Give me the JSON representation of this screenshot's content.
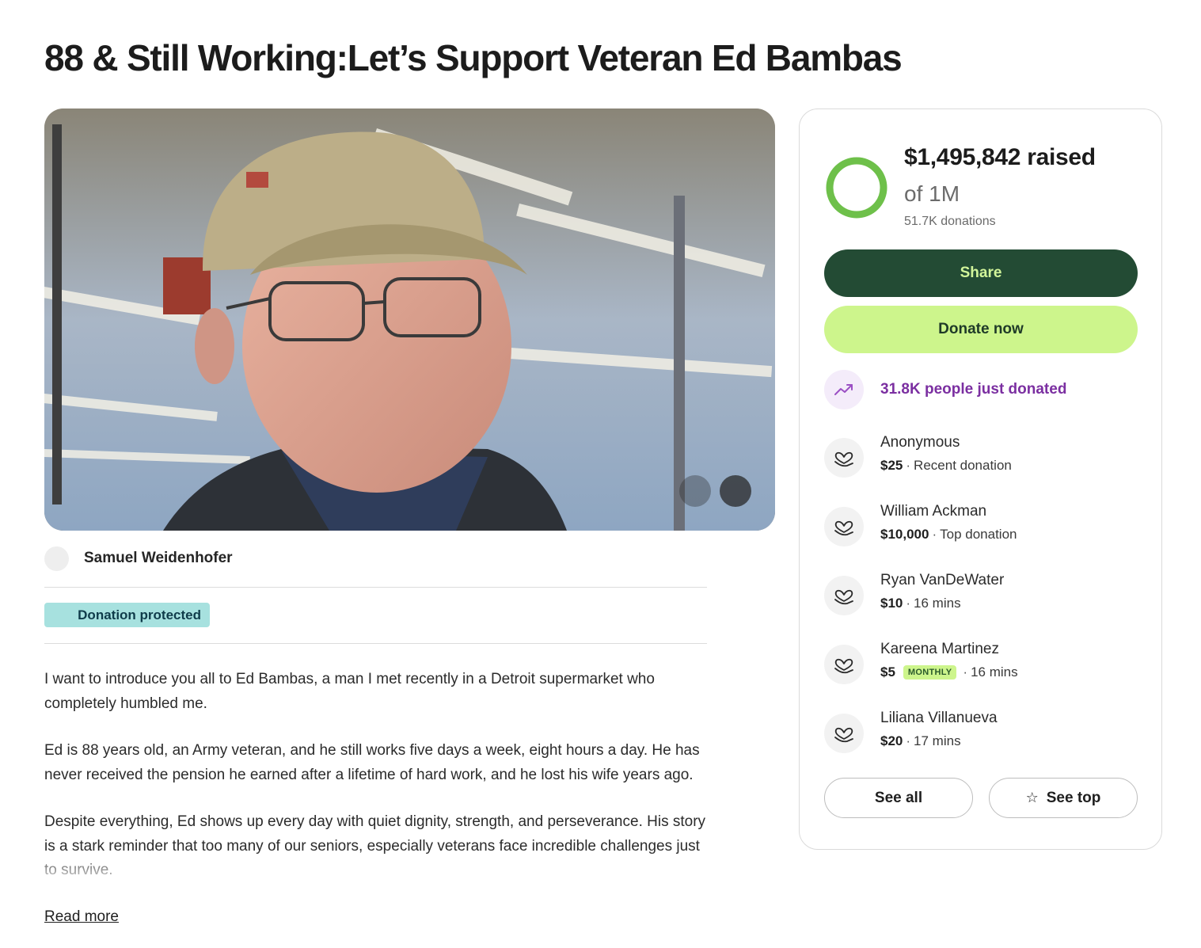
{
  "title": "88 & Still Working:Let’s Support Veteran Ed Bambas",
  "organizer": {
    "name": "Samuel Weidenhofer"
  },
  "badge": "Donation protected",
  "story": {
    "paragraphs": [
      "I want to introduce you all to Ed Bambas, a man I met recently in a Detroit supermarket who completely humbled me.",
      "Ed is 88 years old, an Army veteran, and he still works five days a week, eight hours a day. He has never received the pension he earned after a lifetime of hard work, and he lost his wife years ago.",
      "Despite everything, Ed shows up every day with quiet dignity, strength, and perseverance. His story is a stark reminder that too many of our seniors, especially veterans face incredible challenges just to survive."
    ],
    "read_more": "Read more"
  },
  "fundraiser": {
    "raised_amount": "$1,495,842",
    "raised_suffix": "raised",
    "goal": "of 1M",
    "donations": "51.7K donations",
    "progress_fraction": 1.0,
    "ring_color": "#6ec04a",
    "share_label": "Share",
    "donate_label": "Donate now",
    "trend_text": "31.8K people just donated"
  },
  "donors": [
    {
      "name": "Anonymous",
      "amount": "$25",
      "detail": "Recent donation",
      "monthly": ""
    },
    {
      "name": "William Ackman",
      "amount": "$10,000",
      "detail": "Top donation",
      "monthly": ""
    },
    {
      "name": "Ryan VanDeWater",
      "amount": "$10",
      "detail": "16 mins",
      "monthly": ""
    },
    {
      "name": "Kareena Martinez",
      "amount": "$5",
      "detail": "16 mins",
      "monthly": "MONTHLY"
    },
    {
      "name": "Liliana Villanueva",
      "amount": "$20",
      "detail": "17 mins",
      "monthly": ""
    }
  ],
  "buttons": {
    "see_all": "See all",
    "see_top": "See top"
  },
  "icons": {
    "trend": "trending-up-icon",
    "donor": "heart-hand-icon",
    "star": "star-icon"
  }
}
